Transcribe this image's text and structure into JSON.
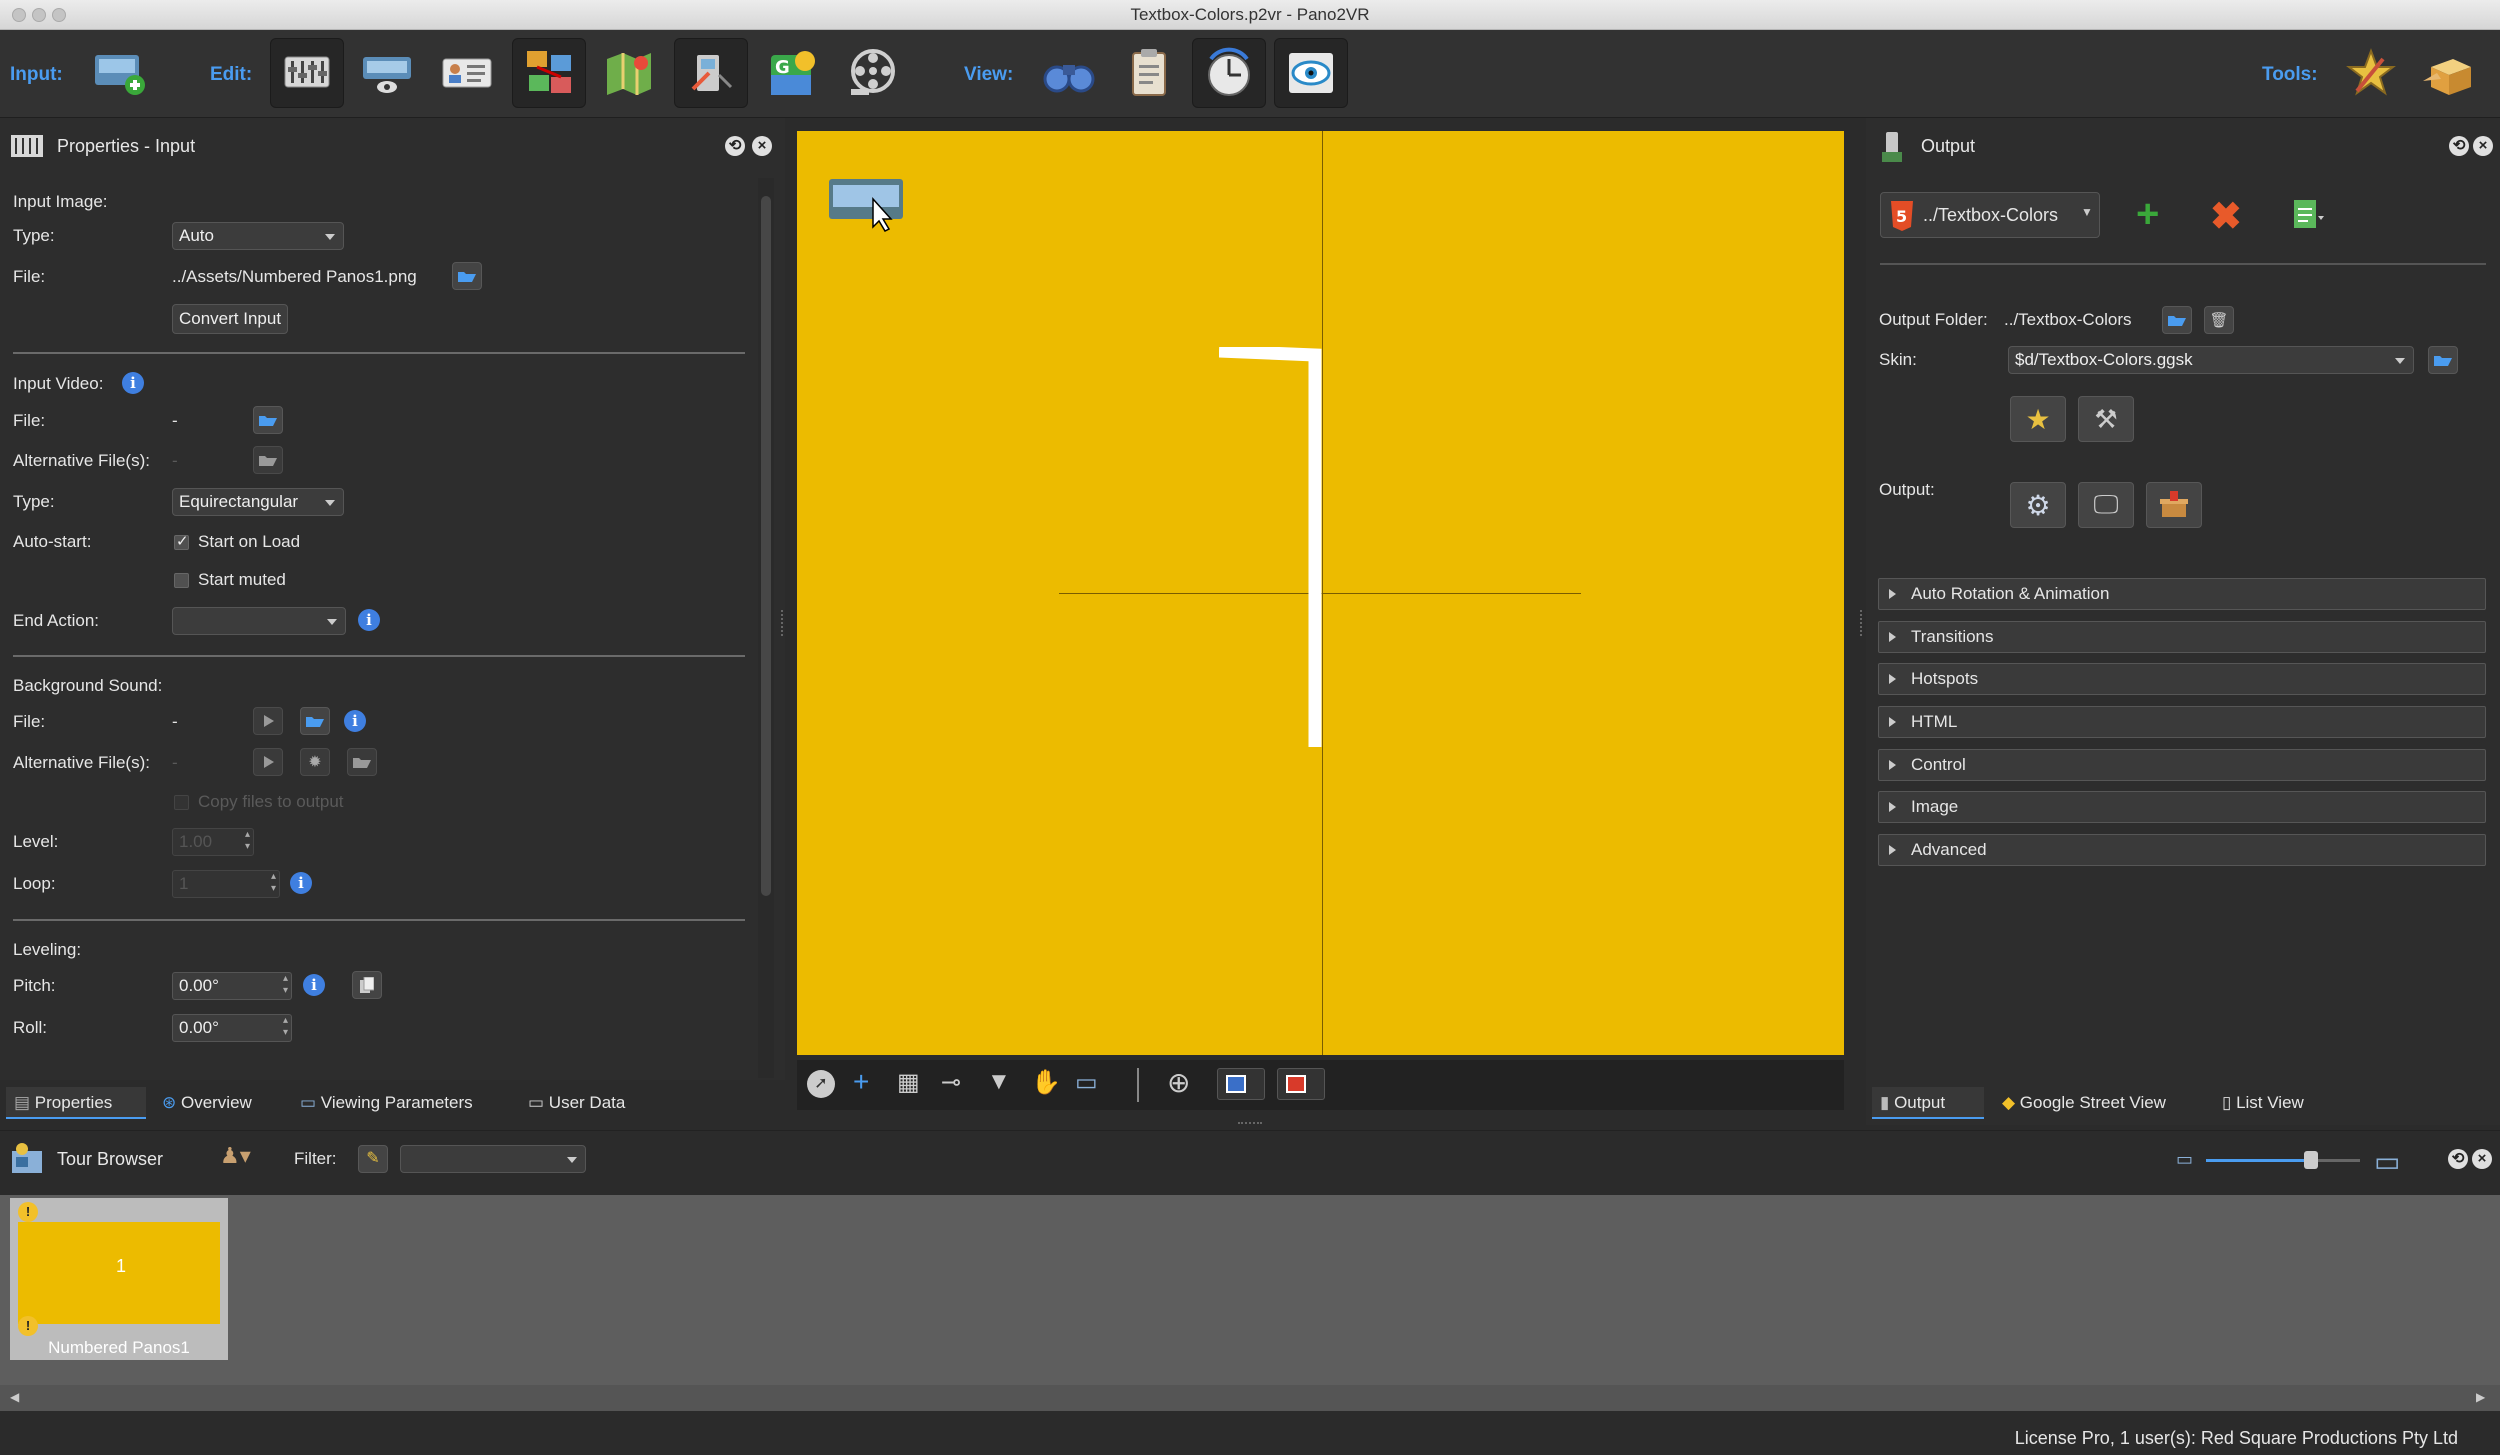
{
  "window": {
    "title": "Textbox-Colors.p2vr - Pano2VR"
  },
  "toolbar": {
    "input_label": "Input:",
    "edit_label": "Edit:",
    "view_label": "View:",
    "tools_label": "Tools:",
    "icons": [
      "add-panorama-icon",
      "properties-icon",
      "viewing-parameters-icon",
      "user-data-icon",
      "hotspots-icon",
      "map-icon",
      "patches-icon",
      "google-maps-icon",
      "animation-icon",
      "tour-preview-icon",
      "clipboard-icon",
      "turntable-icon",
      "eye-view-icon",
      "skin-editor-icon",
      "gift-box-icon"
    ]
  },
  "properties": {
    "title": "Properties - Input",
    "input_image_heading": "Input Image:",
    "type_label": "Type:",
    "type_value": "Auto",
    "file_label": "File:",
    "file_value": "../Assets/Numbered Panos1.png",
    "convert_button": "Convert Input",
    "input_video_heading": "Input Video:",
    "video_file_label": "File:",
    "video_file_value": "-",
    "video_alt_label": "Alternative File(s):",
    "video_alt_value": "-",
    "video_type_label": "Type:",
    "video_type_value": "Equirectangular",
    "autostart_label": "Auto-start:",
    "start_on_load": "Start on Load",
    "start_muted": "Start muted",
    "end_action_label": "End Action:",
    "end_action_value": "",
    "bg_sound_heading": "Background Sound:",
    "sound_file_label": "File:",
    "sound_file_value": "-",
    "sound_alt_label": "Alternative File(s):",
    "sound_alt_value": "-",
    "copy_files": "Copy files to output",
    "level_label": "Level:",
    "level_value": "1.00",
    "loop_label": "Loop:",
    "loop_value": "1",
    "leveling_heading": "Leveling:",
    "pitch_label": "Pitch:",
    "pitch_value": "0.00°",
    "roll_label": "Roll:",
    "roll_value": "0.00°"
  },
  "left_tabs": [
    "Properties",
    "Overview",
    "Viewing Parameters",
    "User Data"
  ],
  "viewer": {
    "panorama_label": "1",
    "background": "#ecbb00"
  },
  "output": {
    "title": "Output",
    "format_value": "../Textbox-Colors",
    "output_folder_label": "Output Folder:",
    "output_folder_value": "../Textbox-Colors",
    "skin_label": "Skin:",
    "skin_value": "$d/Textbox-Colors.ggsk",
    "output_label": "Output:",
    "sections": [
      "Auto Rotation & Animation",
      "Transitions",
      "Hotspots",
      "HTML",
      "Control",
      "Image",
      "Advanced"
    ]
  },
  "right_tabs": [
    "Output",
    "Google Street View",
    "List View"
  ],
  "tour": {
    "title": "Tour Browser",
    "filter_label": "Filter:",
    "filter_value": "",
    "thumb_label": "Numbered Panos1",
    "thumb_number": "1"
  },
  "status": {
    "license": "License Pro, 1 user(s): Red Square Productions Pty Ltd"
  },
  "colors": {
    "accent": "#4a9cf0",
    "panorama": "#ecbb00",
    "panel": "#2b2b2b"
  }
}
